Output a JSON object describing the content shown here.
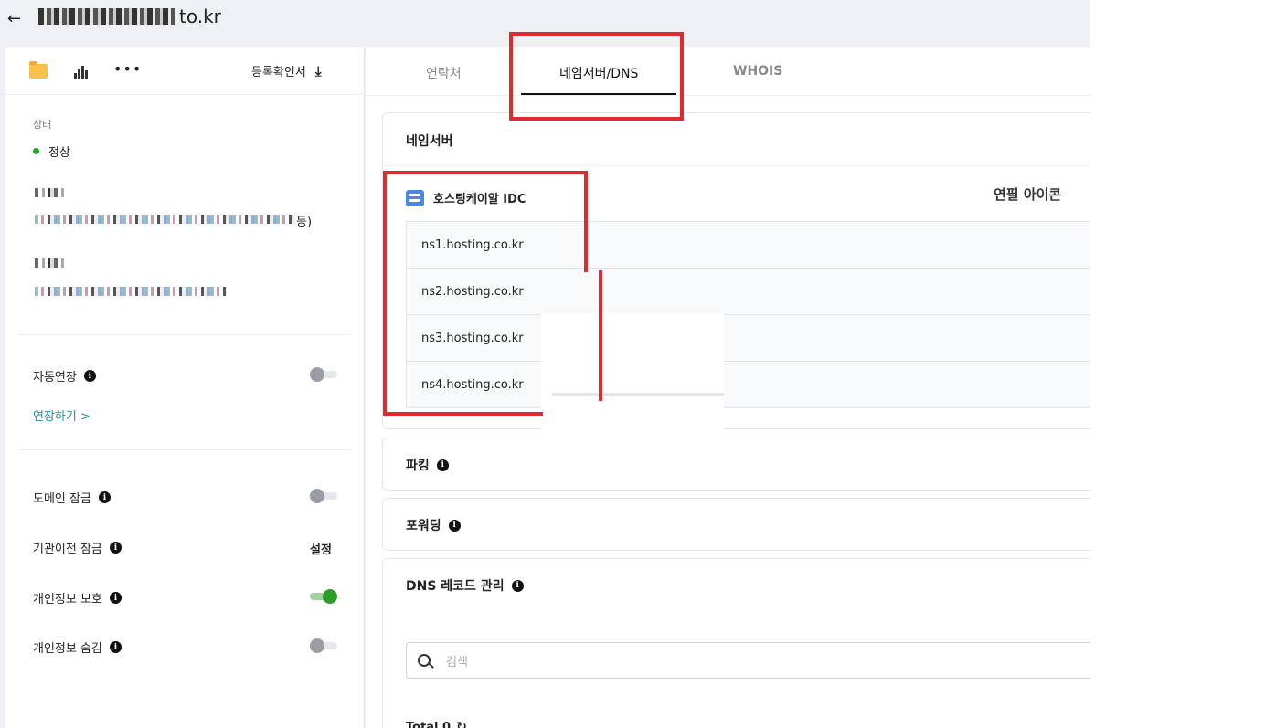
{
  "header": {
    "domain_suffix": "to.kr"
  },
  "toolbar": {
    "cert_label": "등록확인서"
  },
  "status": {
    "label": "상태",
    "value": "정상"
  },
  "nameserver_info": {
    "suffix": "등)"
  },
  "options": {
    "auto_renew": {
      "label": "자동연장",
      "on": false
    },
    "renew_link": "연장하기 >",
    "domain_lock": {
      "label": "도메인 잠금",
      "on": false
    },
    "transfer_lock": {
      "label": "기관이전 잠금",
      "action": "설정"
    },
    "privacy_protect": {
      "label": "개인정보 보호",
      "on": true
    },
    "privacy_hide": {
      "label": "개인정보 숨김",
      "on": false
    }
  },
  "tabs": [
    "연락처",
    "네임서버/DNS",
    "WHOIS"
  ],
  "nameserver": {
    "title": "네임서버",
    "provider": "호스팅케이알 IDC",
    "servers": [
      "ns1.hosting.co.kr",
      "ns2.hosting.co.kr",
      "ns3.hosting.co.kr",
      "ns4.hosting.co.kr"
    ],
    "annotation": "연필 아이콘"
  },
  "sections": {
    "parking": "파킹",
    "forwarding": "포워딩",
    "dns_records": "DNS 레코드 관리"
  },
  "search": {
    "placeholder": "검색"
  },
  "total": {
    "label": "Total",
    "count": "0"
  },
  "colors": {
    "highlight": "#e02b2e",
    "link": "#1e8fa8",
    "toggle_on": "#2a9d2a",
    "status_ok": "#2aa033"
  }
}
